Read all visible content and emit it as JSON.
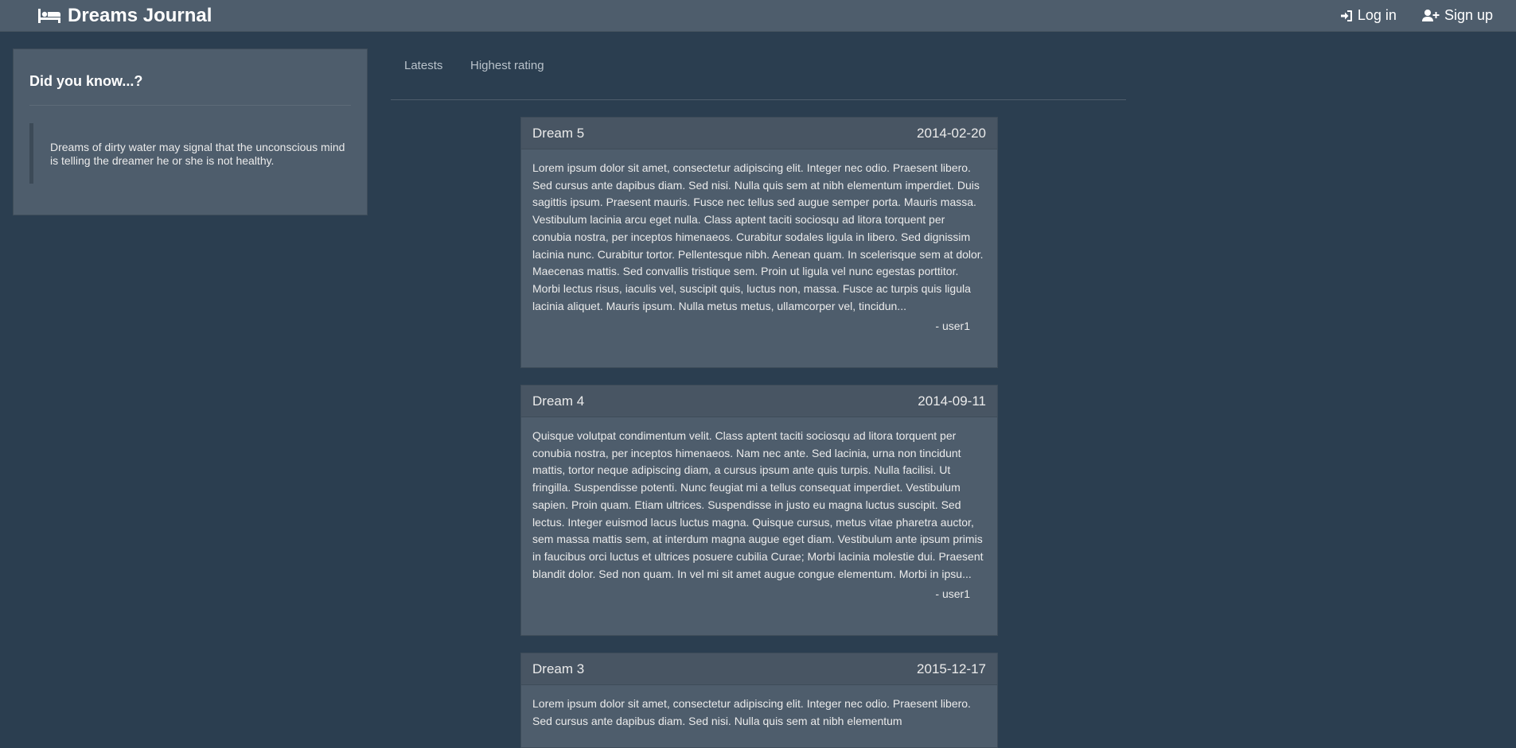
{
  "navbar": {
    "brand": "Dreams Journal",
    "brand_icon": "bed-icon",
    "login_label": "Log in",
    "login_icon": "sign-in-icon",
    "signup_label": "Sign up",
    "signup_icon": "user-plus-icon"
  },
  "sidebar": {
    "title": "Did you know...?",
    "tip": "Dreams of dirty water may signal that the unconscious mind is telling the dreamer he or she is not healthy."
  },
  "tabs": [
    {
      "label": "Latests"
    },
    {
      "label": "Highest rating"
    }
  ],
  "dreams": [
    {
      "title": "Dream 5",
      "date": "2014-02-20",
      "body": "Lorem ipsum dolor sit amet, consectetur adipiscing elit. Integer nec odio. Praesent libero. Sed cursus ante dapibus diam. Sed nisi. Nulla quis sem at nibh elementum imperdiet. Duis sagittis ipsum. Praesent mauris. Fusce nec tellus sed augue semper porta. Mauris massa. Vestibulum lacinia arcu eget nulla. Class aptent taciti sociosqu ad litora torquent per conubia nostra, per inceptos himenaeos. Curabitur sodales ligula in libero. Sed dignissim lacinia nunc. Curabitur tortor. Pellentesque nibh. Aenean quam. In scelerisque sem at dolor. Maecenas mattis. Sed convallis tristique sem. Proin ut ligula vel nunc egestas porttitor. Morbi lectus risus, iaculis vel, suscipit quis, luctus non, massa. Fusce ac turpis quis ligula lacinia aliquet. Mauris ipsum. Nulla metus metus, ullamcorper vel, tincidun...",
      "author": "- user1"
    },
    {
      "title": "Dream 4",
      "date": "2014-09-11",
      "body": "Quisque volutpat condimentum velit. Class aptent taciti sociosqu ad litora torquent per conubia nostra, per inceptos himenaeos. Nam nec ante. Sed lacinia, urna non tincidunt mattis, tortor neque adipiscing diam, a cursus ipsum ante quis turpis. Nulla facilisi. Ut fringilla. Suspendisse potenti. Nunc feugiat mi a tellus consequat imperdiet. Vestibulum sapien. Proin quam. Etiam ultrices. Suspendisse in justo eu magna luctus suscipit. Sed lectus. Integer euismod lacus luctus magna. Quisque cursus, metus vitae pharetra auctor, sem massa mattis sem, at interdum magna augue eget diam. Vestibulum ante ipsum primis in faucibus orci luctus et ultrices posuere cubilia Curae; Morbi lacinia molestie dui. Praesent blandit dolor. Sed non quam. In vel mi sit amet augue congue elementum. Morbi in ipsu...",
      "author": "- user1"
    },
    {
      "title": "Dream 3",
      "date": "2015-12-17",
      "body": "Lorem ipsum dolor sit amet, consectetur adipiscing elit. Integer nec odio. Praesent libero. Sed cursus ante dapibus diam. Sed nisi. Nulla quis sem at nibh elementum",
      "author": ""
    }
  ],
  "colors": {
    "background": "#2b3e50",
    "panel": "#4e5d6c",
    "text": "#ebebeb"
  }
}
